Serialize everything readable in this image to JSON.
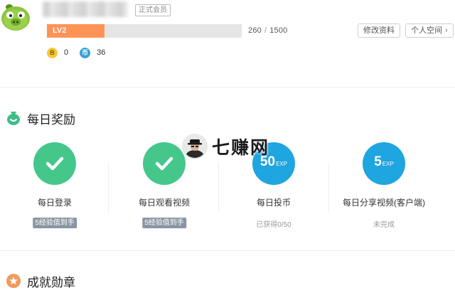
{
  "profile": {
    "member_badge": "正式会员",
    "level_label": "LV2",
    "level_progress_fraction": 0.2945,
    "exp_current": "260",
    "exp_separator": "/",
    "exp_total": "1500",
    "edit_button": "修改资料",
    "space_button": "个人空间",
    "bcoin_icon_text": "B",
    "bcoin_value": "0",
    "coin_icon_text": "币",
    "coin_value": "36"
  },
  "daily": {
    "title": "每日奖励",
    "items": [
      {
        "title": "每日登录",
        "state": "done",
        "tag": "5经验值到手",
        "icon": "check-icon"
      },
      {
        "title": "每日观看视频",
        "state": "done",
        "tag": "5经验值到手",
        "icon": "check-icon"
      },
      {
        "title": "每日投币",
        "state": "pending",
        "exp_number": "50",
        "exp_unit": "EXP",
        "status": "已获得0/50"
      },
      {
        "title": "每日分享视频(客户端)",
        "state": "pending",
        "exp_number": "5",
        "exp_unit": "EXP",
        "status": "未完成"
      }
    ]
  },
  "achievements": {
    "title": "成就勋章"
  },
  "watermark": {
    "text": "七赚网"
  },
  "colors": {
    "level_fill": "#ff9356",
    "level_track": "#e5e5e5",
    "done_green": "#45c78b",
    "pending_blue": "#1fa5e0",
    "tag_gray": "#8a95a3",
    "daily_icon": "#3fbd89",
    "achievement_icon": "#f39a5b"
  }
}
